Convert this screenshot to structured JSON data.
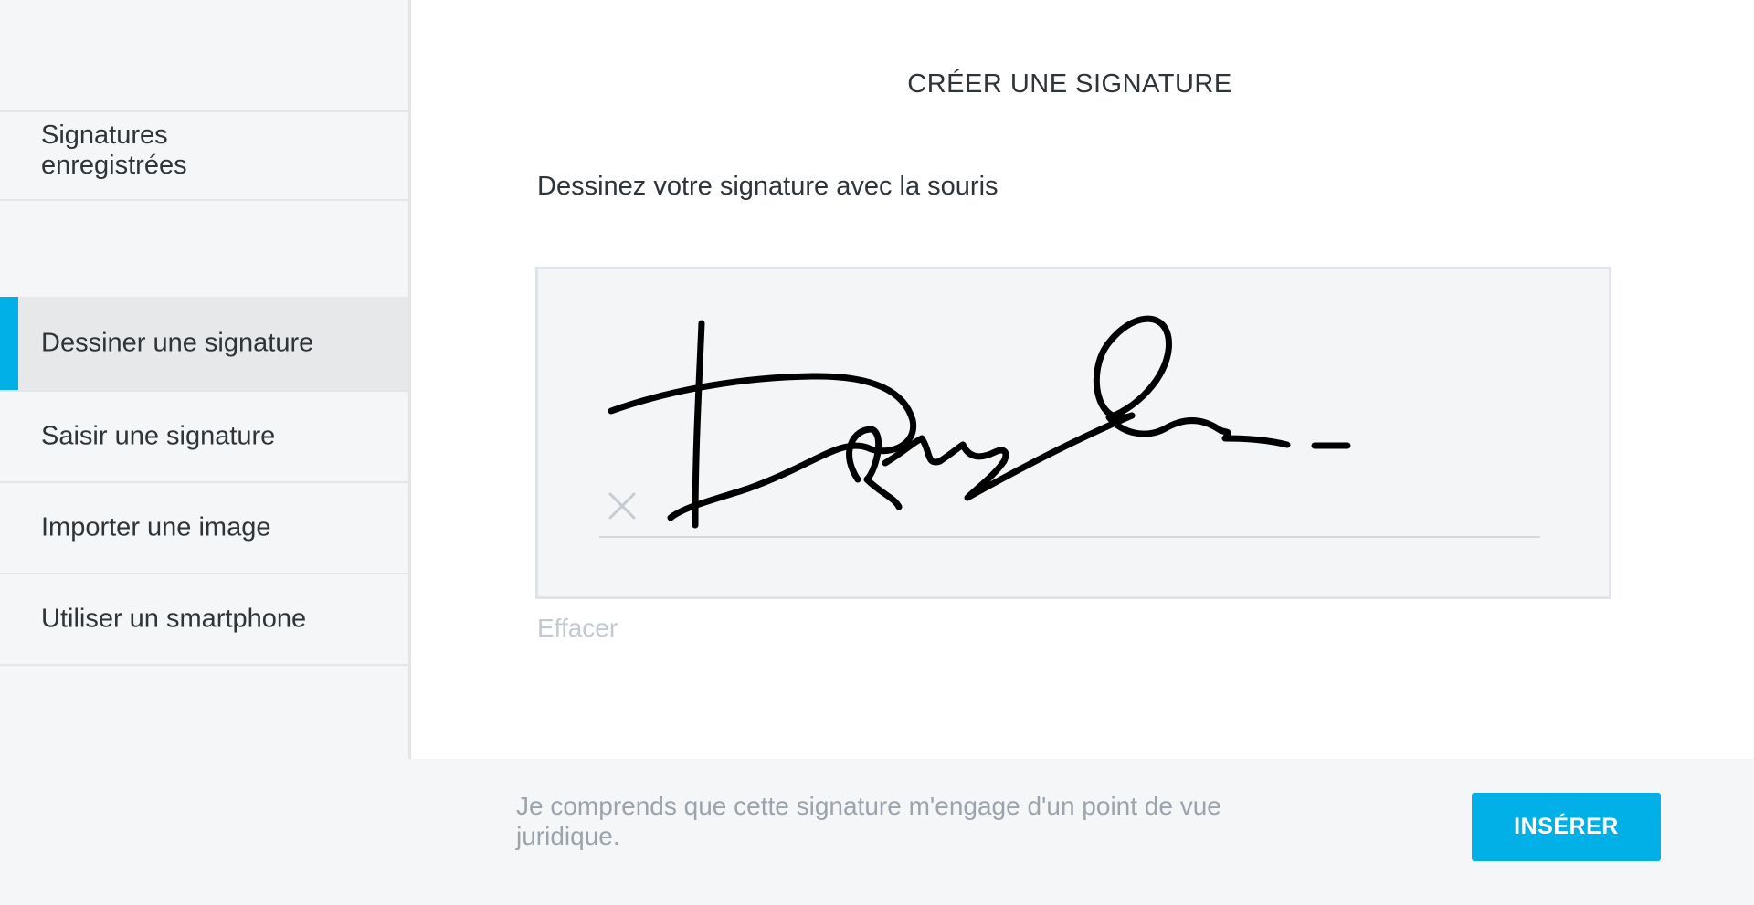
{
  "sidebar": {
    "saved_label": "Signatures\nenregistrées",
    "items": [
      {
        "label": "Dessiner une signature",
        "active": true
      },
      {
        "label": "Saisir une signature",
        "active": false
      },
      {
        "label": "Importer une image",
        "active": false
      },
      {
        "label": "Utiliser un smartphone",
        "active": false
      }
    ]
  },
  "main": {
    "title": "CRÉER UNE SIGNATURE",
    "instruction": "Dessinez votre signature avec la souris",
    "clear_label": "Effacer",
    "x_mark_icon": "close-icon"
  },
  "footer": {
    "legal_text": "Je comprends que cette signature m'engage d'un point de vue juridique.",
    "insert_label": "INSÉRER"
  },
  "colors": {
    "accent": "#00b0e6",
    "sidebar_bg": "#f5f6f7",
    "active_item_bg": "#e7e8e9",
    "pad_bg": "#f4f5f6",
    "text": "#2f3439",
    "muted_text": "#9ba3ad",
    "signature_ink": "#000000"
  }
}
